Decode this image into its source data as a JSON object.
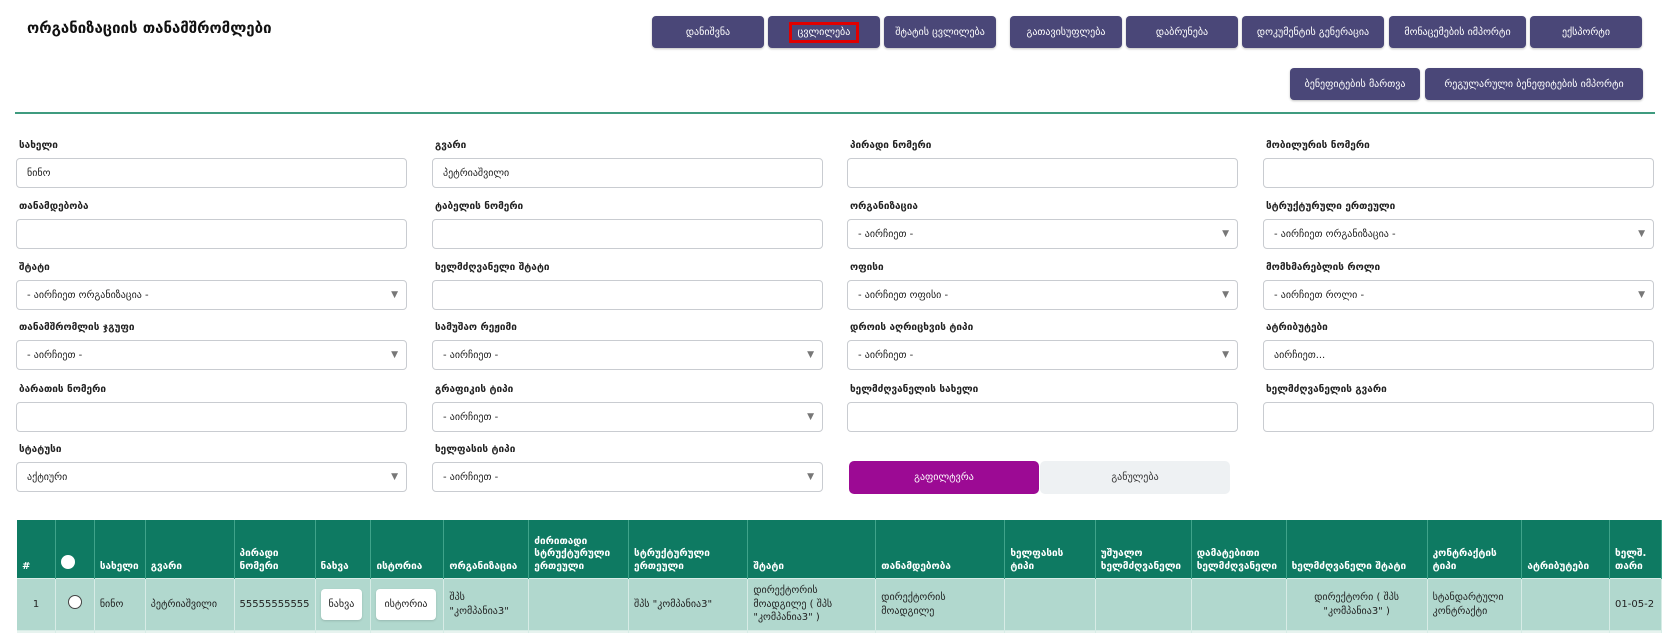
{
  "page_title": "ორგანიზაციის თანამშრომლები",
  "toolbar": {
    "row1": [
      "დანიშვნა",
      "ცვლილება",
      "შტატის ცვლილება",
      "გათავისუფლება",
      "დაბრუნება",
      "დოკუმენტის გენერაცია",
      "მონაცემების იმპორტი",
      "ექსპორტი"
    ],
    "row2": [
      "ბენეფიტების მართვა",
      "რეგულარული ბენეფიტების იმპორტი"
    ]
  },
  "filters": {
    "name": {
      "label": "სახელი",
      "value": "ნინო"
    },
    "surname": {
      "label": "გვარი",
      "value": "პეტრიაშვილი"
    },
    "personal_number": {
      "label": "პირადი ნომერი",
      "value": ""
    },
    "mobile": {
      "label": "მობილურის ნომერი",
      "value": ""
    },
    "position": {
      "label": "თანამდებობა",
      "value": ""
    },
    "table_number": {
      "label": "ტაბელის ნომერი",
      "value": ""
    },
    "organization": {
      "label": "ორგანიზაცია",
      "value": "- აირჩიეთ -"
    },
    "structural_unit": {
      "label": "სტრუქტურული ერთეული",
      "value": "- აირჩიეთ ორგანიზაცია -"
    },
    "staff": {
      "label": "შტატი",
      "value": "- აირჩიეთ ორგანიზაცია -"
    },
    "manager_staff": {
      "label": "ხელმძღვანელი შტატი",
      "value": ""
    },
    "office": {
      "label": "ოფისი",
      "value": "- აირჩიეთ ოფისი -"
    },
    "user_role": {
      "label": "მომხმარებლის როლი",
      "value": "- აირჩიეთ როლი -"
    },
    "employee_group": {
      "label": "თანამშრომლის ჯგუფი",
      "value": "- აირჩიეთ -"
    },
    "work_regime": {
      "label": "სამუშაო რეჟიმი",
      "value": "- აირჩიეთ -"
    },
    "time_tracking": {
      "label": "დროის აღრიცხვის ტიპი",
      "value": "- აირჩიეთ -"
    },
    "attributes": {
      "label": "ატრიბუტები",
      "value": "აირჩიეთ..."
    },
    "card_number": {
      "label": "ბარათის ნომერი",
      "value": ""
    },
    "schedule_type": {
      "label": "გრაფიკის ტიპი",
      "value": "- აირჩიეთ -"
    },
    "manager_name": {
      "label": "ხელმძღვანელის სახელი",
      "value": ""
    },
    "manager_surname": {
      "label": "ხელმძღვანელის გვარი",
      "value": ""
    },
    "status": {
      "label": "სტატუსი",
      "value": "აქტიური"
    },
    "salary_type": {
      "label": "ხელფასის ტიპი",
      "value": "- აირჩიეთ -"
    }
  },
  "actions": {
    "filter": "გაფილტვრა",
    "reset": "განულება"
  },
  "table": {
    "headers": [
      "#",
      "",
      "სახელი",
      "გვარი",
      "პირადი ნომერი",
      "ნახვა",
      "ისტორია",
      "ორგანიზაცია",
      "ძირითადი სტრუქტურული ერთეული",
      "სტრუქტურული ერთეული",
      "შტატი",
      "თანამდებობა",
      "ხელფასის ტიპი",
      "უშუალო ხელმძღვანელი",
      "დამატებითი ხელმძღვანელი",
      "ხელმძღვანელი შტატი",
      "კონტრაქტის ტიპი",
      "ატრიბუტები",
      "ხელშ. თარი"
    ],
    "rows": [
      {
        "num": "1",
        "name": "ნინო",
        "surname": "პეტრიაშვილი",
        "personal_number": "55555555555",
        "view": "ნახვა",
        "history": "ისტორია",
        "organization": "შპს \"კომპანია3\"",
        "main_unit": "",
        "unit": "შპს \"კომპანია3\"",
        "staff": "დირექტორის მოადგილე ( შპს \"კომპანია3\" )",
        "position": "დირექტორის მოადგილე",
        "salary_type": "",
        "direct_manager": "",
        "additional_manager": "",
        "manager_staff": "დირექტორი ( შპს \"კომპანია3\" )",
        "contract_type": "სტანდარტული კონტრაქტი",
        "attributes": "",
        "contract_date": "01-05-2"
      }
    ]
  }
}
